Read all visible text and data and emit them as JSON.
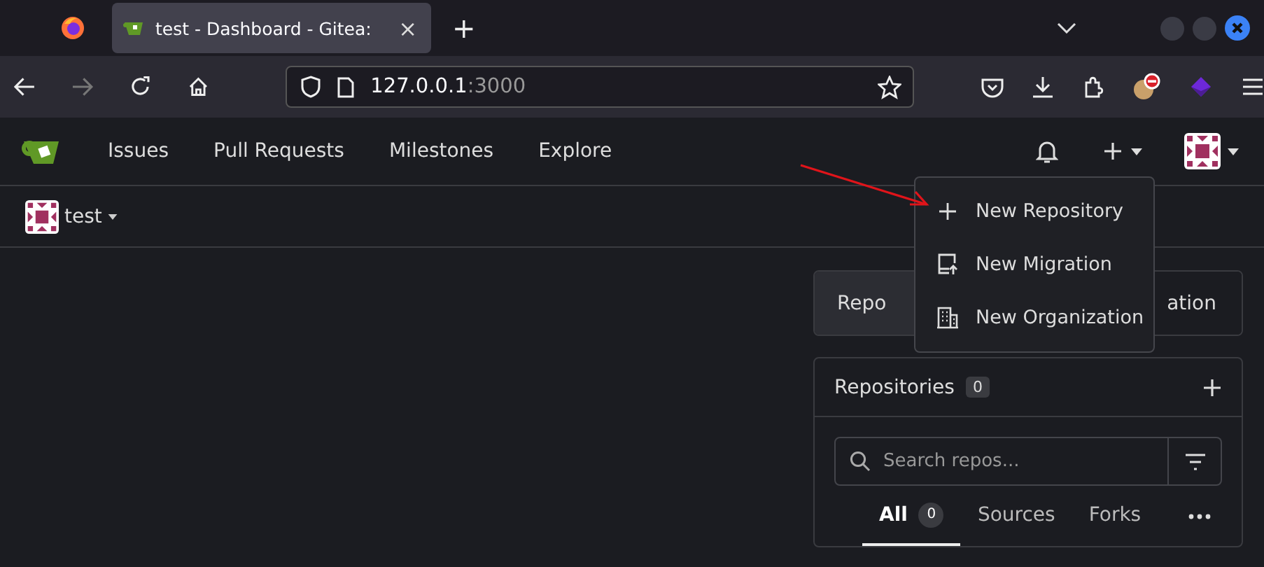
{
  "browser": {
    "tab_title": "test - Dashboard - Gitea:",
    "tab_close": "×",
    "new_tab": "+",
    "url_host": "127.0.0.1",
    "url_port": ":3000"
  },
  "nav": {
    "items": [
      {
        "label": "Issues"
      },
      {
        "label": "Pull Requests"
      },
      {
        "label": "Milestones"
      },
      {
        "label": "Explore"
      }
    ]
  },
  "context": {
    "user": "test"
  },
  "create_menu": {
    "items": [
      {
        "kind": "repo",
        "label": "New Repository"
      },
      {
        "kind": "migration",
        "label": "New Migration"
      },
      {
        "kind": "org",
        "label": "New Organization"
      }
    ]
  },
  "switch_buttons": [
    {
      "label": "Repo",
      "selected": true
    },
    {
      "label": "ation",
      "selected": false
    }
  ],
  "repos_panel": {
    "title": "Repositories",
    "count": "0",
    "search": {
      "placeholder": "Search repos..."
    },
    "tabs": [
      {
        "label": "All",
        "count": "0",
        "selected": true
      },
      {
        "label": "Sources",
        "selected": false
      },
      {
        "label": "Forks",
        "selected": false
      }
    ]
  }
}
